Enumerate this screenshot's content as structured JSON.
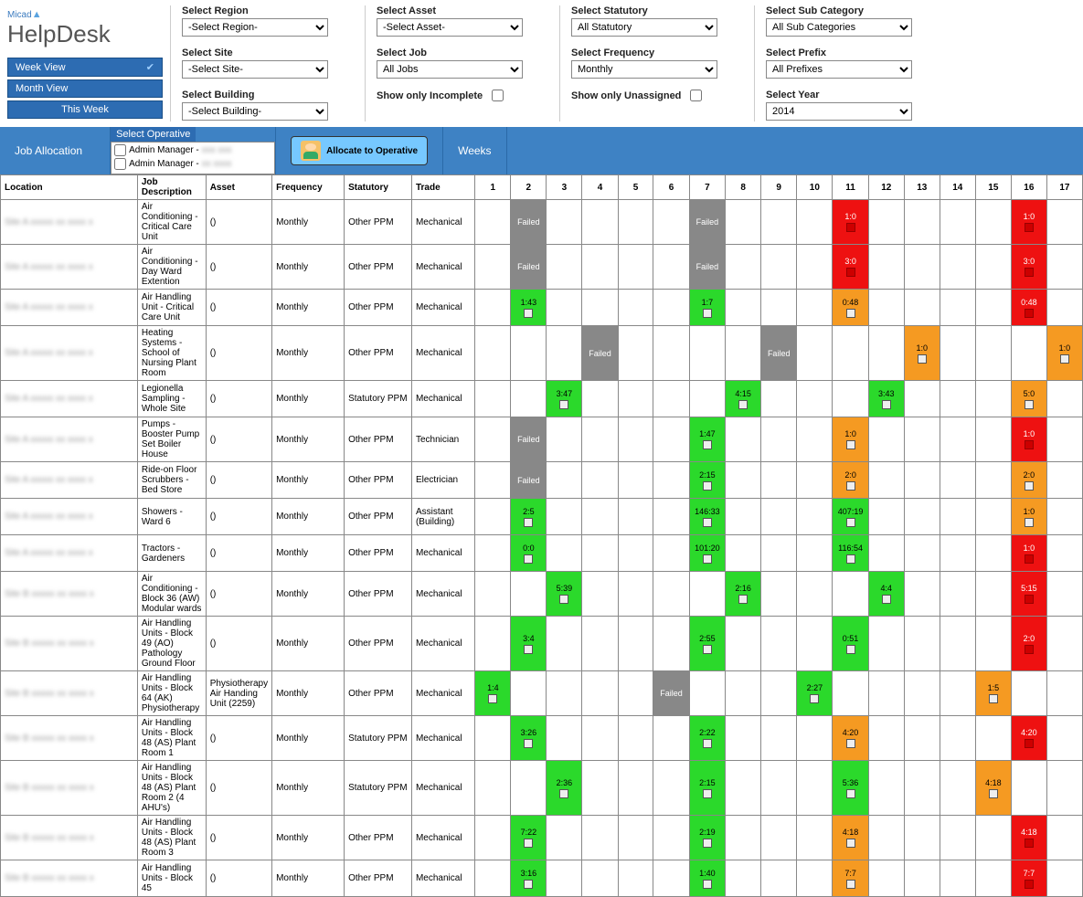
{
  "brand": {
    "small": "Micad",
    "big": "HelpDesk"
  },
  "nav": {
    "week": "Week View",
    "month": "Month View",
    "this": "This Week"
  },
  "filters": {
    "region": {
      "label": "Select Region",
      "value": "-Select Region-"
    },
    "site": {
      "label": "Select Site",
      "value": "-Select Site-"
    },
    "building": {
      "label": "Select Building",
      "value": "-Select Building-"
    },
    "asset": {
      "label": "Select Asset",
      "value": "-Select Asset-"
    },
    "job": {
      "label": "Select Job",
      "value": "All Jobs"
    },
    "incomplete": {
      "label": "Show only Incomplete"
    },
    "statutory": {
      "label": "Select Statutory",
      "value": "All Statutory"
    },
    "frequency": {
      "label": "Select Frequency",
      "value": "Monthly"
    },
    "unassigned": {
      "label": "Show only Unassigned"
    },
    "subcat": {
      "label": "Select Sub Category",
      "value": "All Sub Categories"
    },
    "prefix": {
      "label": "Select Prefix",
      "value": "All Prefixes"
    },
    "year": {
      "label": "Select Year",
      "value": "2014"
    }
  },
  "bar": {
    "jobAllocation": "Job Allocation",
    "selectOperative": "Select Operative",
    "op1": "Admin Manager -",
    "op2": "Admin Manager -",
    "allocate": "Allocate to Operative",
    "weeks": "Weeks"
  },
  "headers": {
    "location": "Location",
    "job": "Job Description",
    "asset": "Asset",
    "freq": "Frequency",
    "stat": "Statutory",
    "trade": "Trade"
  },
  "weeks": [
    "1",
    "2",
    "3",
    "4",
    "5",
    "6",
    "7",
    "8",
    "9",
    "10",
    "11",
    "12",
    "13",
    "14",
    "15",
    "16",
    "17"
  ],
  "rows": [
    {
      "loc": "Site A",
      "job": "Air Conditioning - Critical Care Unit",
      "asset": "()",
      "freq": "Monthly",
      "stat": "Other PPM",
      "trade": "Mechanical",
      "cells": {
        "2": {
          "t": "Failed",
          "c": "f"
        },
        "7": {
          "t": "Failed",
          "c": "f"
        },
        "11": {
          "t": "1:0",
          "c": "r"
        },
        "16": {
          "t": "1:0",
          "c": "r"
        }
      }
    },
    {
      "loc": "Site A",
      "job": "Air Conditioning - Day Ward Extention",
      "asset": "()",
      "freq": "Monthly",
      "stat": "Other PPM",
      "trade": "Mechanical",
      "cells": {
        "2": {
          "t": "Failed",
          "c": "f"
        },
        "7": {
          "t": "Failed",
          "c": "f"
        },
        "11": {
          "t": "3:0",
          "c": "r"
        },
        "16": {
          "t": "3:0",
          "c": "r"
        }
      }
    },
    {
      "loc": "Site A",
      "job": "Air Handling Unit - Critical Care Unit",
      "asset": "()",
      "freq": "Monthly",
      "stat": "Other PPM",
      "trade": "Mechanical",
      "cells": {
        "2": {
          "t": "1:43",
          "c": "g"
        },
        "7": {
          "t": "1:7",
          "c": "g"
        },
        "11": {
          "t": "0:48",
          "c": "o"
        },
        "16": {
          "t": "0:48",
          "c": "r"
        }
      }
    },
    {
      "loc": "Site A",
      "job": "Heating Systems - School of Nursing Plant Room",
      "asset": "()",
      "freq": "Monthly",
      "stat": "Other PPM",
      "trade": "Mechanical",
      "cells": {
        "4": {
          "t": "Failed",
          "c": "f"
        },
        "9": {
          "t": "Failed",
          "c": "f"
        },
        "13": {
          "t": "1:0",
          "c": "o"
        },
        "17": {
          "t": "1:0",
          "c": "o"
        }
      }
    },
    {
      "loc": "Site A",
      "job": "Legionella Sampling - Whole Site",
      "asset": "()",
      "freq": "Monthly",
      "stat": "Statutory PPM",
      "trade": "Mechanical",
      "cells": {
        "3": {
          "t": "3:47",
          "c": "g"
        },
        "8": {
          "t": "4:15",
          "c": "g"
        },
        "12": {
          "t": "3:43",
          "c": "g"
        },
        "16": {
          "t": "5:0",
          "c": "o"
        }
      }
    },
    {
      "loc": "Site A",
      "job": "Pumps - Booster Pump Set Boiler House",
      "asset": "()",
      "freq": "Monthly",
      "stat": "Other PPM",
      "trade": "Technician",
      "cells": {
        "2": {
          "t": "Failed",
          "c": "f"
        },
        "7": {
          "t": "1:47",
          "c": "g"
        },
        "11": {
          "t": "1:0",
          "c": "o"
        },
        "16": {
          "t": "1:0",
          "c": "r"
        }
      }
    },
    {
      "loc": "Site A",
      "job": "Ride-on Floor Scrubbers - Bed Store",
      "asset": "()",
      "freq": "Monthly",
      "stat": "Other PPM",
      "trade": "Electrician",
      "cells": {
        "2": {
          "t": "Failed",
          "c": "f"
        },
        "7": {
          "t": "2:15",
          "c": "g"
        },
        "11": {
          "t": "2:0",
          "c": "o"
        },
        "16": {
          "t": "2:0",
          "c": "o"
        }
      }
    },
    {
      "loc": "Site A",
      "job": "Showers - Ward 6",
      "asset": "()",
      "freq": "Monthly",
      "stat": "Other PPM",
      "trade": "Assistant (Building)",
      "cells": {
        "2": {
          "t": "2:5",
          "c": "g"
        },
        "7": {
          "t": "146:33",
          "c": "g"
        },
        "11": {
          "t": "407:19",
          "c": "g"
        },
        "16": {
          "t": "1:0",
          "c": "o"
        }
      }
    },
    {
      "loc": "Site A",
      "job": "Tractors - Gardeners",
      "asset": "()",
      "freq": "Monthly",
      "stat": "Other PPM",
      "trade": "Mechanical",
      "cells": {
        "2": {
          "t": "0:0",
          "c": "g"
        },
        "7": {
          "t": "101:20",
          "c": "g"
        },
        "11": {
          "t": "116:54",
          "c": "g"
        },
        "16": {
          "t": "1:0",
          "c": "r"
        }
      }
    },
    {
      "loc": "Site B",
      "job": "Air Conditioning - Block 36 (AW) Modular wards",
      "asset": "()",
      "freq": "Monthly",
      "stat": "Other PPM",
      "trade": "Mechanical",
      "cells": {
        "3": {
          "t": "5:39",
          "c": "g"
        },
        "8": {
          "t": "2:16",
          "c": "g"
        },
        "12": {
          "t": "4:4",
          "c": "g"
        },
        "16": {
          "t": "5:15",
          "c": "r"
        }
      }
    },
    {
      "loc": "Site B",
      "job": "Air Handling Units - Block 49 (AO) Pathology Ground Floor",
      "asset": "()",
      "freq": "Monthly",
      "stat": "Other PPM",
      "trade": "Mechanical",
      "cells": {
        "2": {
          "t": "3:4",
          "c": "g"
        },
        "7": {
          "t": "2:55",
          "c": "g"
        },
        "11": {
          "t": "0:51",
          "c": "g"
        },
        "16": {
          "t": "2:0",
          "c": "r"
        }
      }
    },
    {
      "loc": "Site B",
      "job": "Air Handling Units - Block 64 (AK) Physiotherapy",
      "asset": "Physiotherapy Air Handing Unit (2259)",
      "freq": "Monthly",
      "stat": "Other PPM",
      "trade": "Mechanical",
      "cells": {
        "1": {
          "t": "1:4",
          "c": "g"
        },
        "6": {
          "t": "Failed",
          "c": "f"
        },
        "10": {
          "t": "2:27",
          "c": "g"
        },
        "15": {
          "t": "1:5",
          "c": "o"
        }
      }
    },
    {
      "loc": "Site B",
      "job": "Air Handling Units - Block 48 (AS) Plant Room 1",
      "asset": "()",
      "freq": "Monthly",
      "stat": "Statutory PPM",
      "trade": "Mechanical",
      "cells": {
        "2": {
          "t": "3:26",
          "c": "g"
        },
        "7": {
          "t": "2:22",
          "c": "g"
        },
        "11": {
          "t": "4:20",
          "c": "o"
        },
        "16": {
          "t": "4:20",
          "c": "r"
        }
      }
    },
    {
      "loc": "Site B",
      "job": "Air Handling Units - Block 48 (AS) Plant Room 2 (4 AHU's)",
      "asset": "()",
      "freq": "Monthly",
      "stat": "Statutory PPM",
      "trade": "Mechanical",
      "cells": {
        "3": {
          "t": "2:36",
          "c": "g"
        },
        "7": {
          "t": "2:15",
          "c": "g"
        },
        "11": {
          "t": "5:36",
          "c": "g"
        },
        "15": {
          "t": "4:18",
          "c": "o"
        }
      }
    },
    {
      "loc": "Site B",
      "job": "Air Handling Units - Block 48 (AS) Plant Room 3",
      "asset": "()",
      "freq": "Monthly",
      "stat": "Other PPM",
      "trade": "Mechanical",
      "cells": {
        "2": {
          "t": "7:22",
          "c": "g"
        },
        "7": {
          "t": "2:19",
          "c": "g"
        },
        "11": {
          "t": "4:18",
          "c": "o"
        },
        "16": {
          "t": "4:18",
          "c": "r"
        }
      }
    },
    {
      "loc": "Site B",
      "job": "Air Handling Units - Block 45",
      "asset": "()",
      "freq": "Monthly",
      "stat": "Other PPM",
      "trade": "Mechanical",
      "cells": {
        "2": {
          "t": "3:16",
          "c": "g"
        },
        "7": {
          "t": "1:40",
          "c": "g"
        },
        "11": {
          "t": "7:7",
          "c": "o"
        },
        "16": {
          "t": "7:7",
          "c": "r"
        }
      }
    }
  ]
}
